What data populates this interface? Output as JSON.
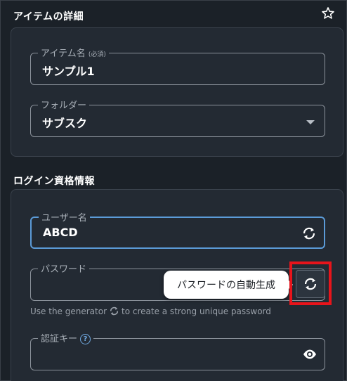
{
  "details": {
    "title": "アイテムの詳細",
    "item_name": {
      "label": "アイテム名",
      "required": "(必須)",
      "value": "サンプル1"
    },
    "folder": {
      "label": "フォルダー",
      "value": "サブスク"
    }
  },
  "login": {
    "title": "ログイン資格情報",
    "username": {
      "label": "ユーザー名",
      "value": "ABCD"
    },
    "password": {
      "label": "パスワード",
      "value": ""
    },
    "tooltip": "パスワードの自動生成",
    "helper_before": "Use the generator",
    "helper_after": "to create a strong unique password",
    "auth_key": {
      "label": "認証キー",
      "value": ""
    }
  },
  "colors": {
    "accent": "#5b9bd8",
    "highlight": "#e8141b"
  }
}
